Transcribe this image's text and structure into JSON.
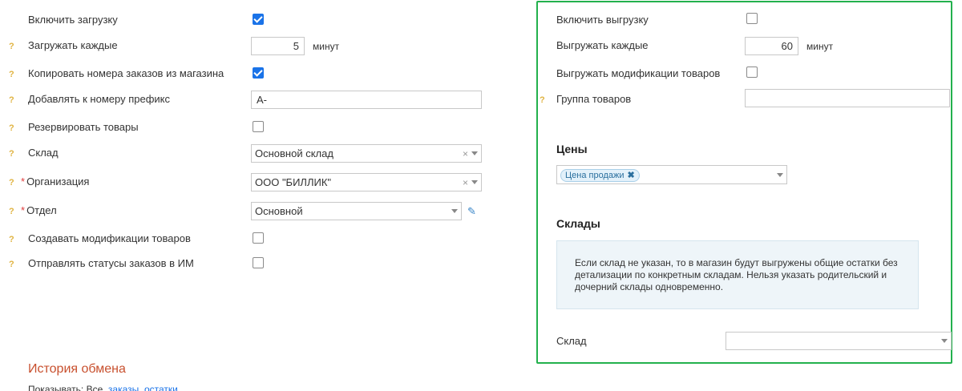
{
  "left": {
    "rows": [
      {
        "label": "Включить загрузку"
      },
      {
        "label": "Загружать каждые",
        "value": "5",
        "unit": "минут"
      },
      {
        "label": "Копировать номера заказов из магазина"
      },
      {
        "label": "Добавлять к номеру префикс",
        "value": "А-"
      },
      {
        "label": "Резервировать товары"
      },
      {
        "label": "Склад",
        "value": "Основной склад"
      },
      {
        "label": "Организация",
        "value": "ООО \"БИЛЛИК\""
      },
      {
        "label": "Отдел",
        "value": "Основной"
      },
      {
        "label": "Создавать модификации товаров"
      },
      {
        "label": "Отправлять статусы заказов в ИМ"
      }
    ],
    "help": "?",
    "required": "*",
    "clear": "×"
  },
  "history": {
    "title": "История обмена",
    "show_label": "Показывать:",
    "all": "Все",
    "orders": "заказы",
    "stock": "остатки"
  },
  "right": {
    "export_enable": "Включить выгрузку",
    "export_every": "Выгружать каждые",
    "export_every_value": "60",
    "export_every_unit": "минут",
    "export_mods": "Выгружать модификации товаров",
    "product_group": "Группа товаров",
    "prices_title": "Цены",
    "price_tag": "Цена продажи",
    "price_tag_remove": "✖",
    "warehouses_title": "Склады",
    "info_text": "Если склад не указан, то в магазин будут выгружены общие остатки без детализации по конкретным складам. Нельзя указать родительский и дочерний склады одновременно.",
    "warehouse_label": "Склад"
  },
  "colors": {
    "accent": "#1a73e8",
    "highlight_border": "#23b14d",
    "history_title": "#c8502e",
    "help": "#e0b341"
  }
}
